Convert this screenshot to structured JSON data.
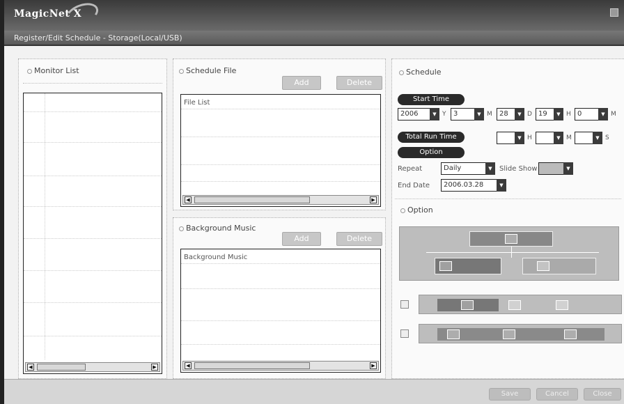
{
  "app": {
    "logo": "MagicNet X",
    "subtitle": "Register/Edit Schedule - Storage(Local/USB)"
  },
  "monitor_list": {
    "title": "Monitor List"
  },
  "schedule_file": {
    "title": "Schedule File",
    "add_label": "Add",
    "delete_label": "Delete",
    "list_header": "File List"
  },
  "background_music": {
    "title": "Background Music",
    "add_label": "Add",
    "delete_label": "Delete",
    "list_header": "Background Music"
  },
  "schedule": {
    "title": "Schedule",
    "start_time_label": "Start Time",
    "year": "2006",
    "year_unit": "Y",
    "month": "3",
    "month_unit": "M",
    "day": "28",
    "day_unit": "D",
    "hour": "19",
    "hour_unit": "H",
    "minute": "0",
    "minute_unit": "M",
    "total_run_time_label": "Total Run Time",
    "run_hour_unit": "H",
    "run_min_unit": "M",
    "run_sec_unit": "S",
    "option_label": "Option",
    "repeat_label": "Repeat",
    "repeat_value": "Daily",
    "slide_show_label": "Slide Show",
    "end_date_label": "End Date",
    "end_date_value": "2006.03.28"
  },
  "option": {
    "title": "Option"
  },
  "footer": {
    "btn1": "Save",
    "btn2": "Cancel",
    "btn3": "Close"
  }
}
